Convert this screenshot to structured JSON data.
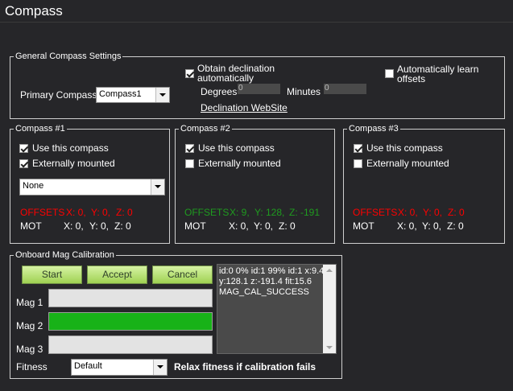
{
  "window": {
    "title": "Compass"
  },
  "general": {
    "legend": "General Compass Settings",
    "primary_label": "Primary Compass:",
    "primary_value": "Compass1",
    "obtain_decl_label": "Obtain declination automatically",
    "obtain_decl_checked": true,
    "degrees_label": "Degrees",
    "degrees_value": "0",
    "minutes_label": "Minutes",
    "minutes_value": "0",
    "decl_link": "Declination WebSite",
    "auto_learn_label": "Automatically learn offsets",
    "auto_learn_checked": false
  },
  "compasses": [
    {
      "legend": "Compass #1",
      "use_label": "Use this compass",
      "use_checked": true,
      "ext_label": "Externally mounted",
      "ext_checked": true,
      "orientation": "None",
      "offsets_label": "OFFSETS",
      "offsets_x": "X: 0,",
      "offsets_y": "Y: 0,",
      "offsets_z": "Z: 0",
      "offsets_color": "#ff0000",
      "mot_label": "MOT",
      "mot_x": "X: 0,",
      "mot_y": "Y: 0,",
      "mot_z": "Z: 0"
    },
    {
      "legend": "Compass #2",
      "use_label": "Use this compass",
      "use_checked": true,
      "ext_label": "Externally mounted",
      "ext_checked": false,
      "offsets_label": "OFFSETS",
      "offsets_x": "X: 9,",
      "offsets_y": "Y: 128,",
      "offsets_z": "Z: -191",
      "offsets_color": "#1f9b1f",
      "mot_label": "MOT",
      "mot_x": "X: 0,",
      "mot_y": "Y: 0,",
      "mot_z": "Z: 0"
    },
    {
      "legend": "Compass #3",
      "use_label": "Use this compass",
      "use_checked": true,
      "ext_label": "Externally mounted",
      "ext_checked": false,
      "offsets_label": "OFFSETS",
      "offsets_x": "X: 0,",
      "offsets_y": "Y: 0,",
      "offsets_z": "Z: 0",
      "offsets_color": "#ff0000",
      "mot_label": "MOT",
      "mot_x": "X: 0,",
      "mot_y": "Y: 0,",
      "mot_z": "Z: 0"
    }
  ],
  "calibration": {
    "legend": "Onboard Mag Calibration",
    "start_label": "Start",
    "accept_label": "Accept",
    "cancel_label": "Cancel",
    "mags": [
      {
        "label": "Mag 1",
        "progress": 0
      },
      {
        "label": "Mag 2",
        "progress": 100
      },
      {
        "label": "Mag 3",
        "progress": 0
      }
    ],
    "log_lines": [
      "id:0 0% id:1 99% id:1 x:9.4",
      "y:128.1 z:-191.4 fit:15.6",
      "MAG_CAL_SUCCESS"
    ],
    "fitness_label": "Fitness",
    "fitness_value": "Default",
    "relax_label": "Relax fitness if calibration fails"
  },
  "colors": {
    "background": "#262629",
    "progress_fill": "#18b218",
    "button": "#b8e07a"
  }
}
